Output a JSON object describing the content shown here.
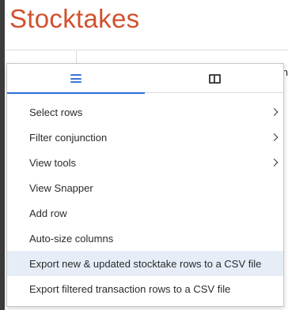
{
  "page": {
    "title": "Stocktakes"
  },
  "grid": {
    "clipped_text": "n"
  },
  "menu": {
    "tabs": [
      {
        "icon": "hamburger-menu-icon",
        "active": true
      },
      {
        "icon": "columns-icon",
        "active": false
      }
    ],
    "items": [
      {
        "label": "Select rows",
        "has_submenu": true
      },
      {
        "label": "Filter conjunction",
        "has_submenu": true
      },
      {
        "label": "View tools",
        "has_submenu": true
      },
      {
        "label": "View Snapper",
        "has_submenu": false
      },
      {
        "label": "Add row",
        "has_submenu": false
      },
      {
        "label": "Auto-size columns",
        "has_submenu": false
      },
      {
        "label": "Export new & updated stocktake rows to a CSV file",
        "has_submenu": false,
        "highlighted": true
      },
      {
        "label": "Export filtered transaction rows to a CSV file",
        "has_submenu": false
      }
    ]
  },
  "colors": {
    "title": "#d2512e",
    "accent": "#2c6fd6",
    "hover": "#e6edf7"
  }
}
